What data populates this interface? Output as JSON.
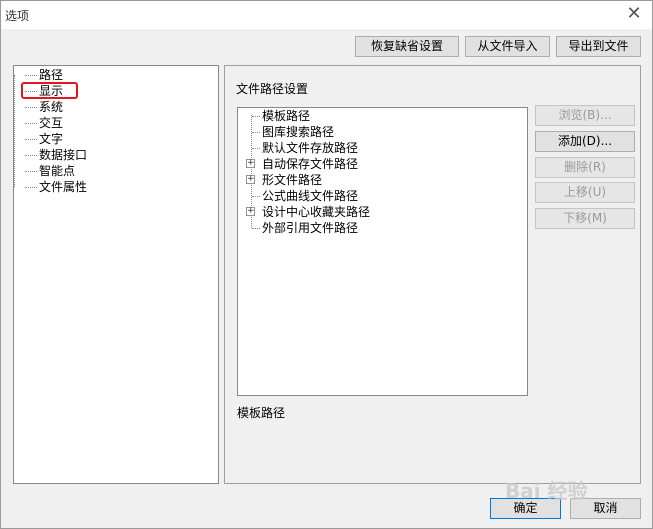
{
  "window": {
    "title": "选项",
    "close_glyph": "✕"
  },
  "top_buttons": {
    "restore_defaults": "恢复缺省设置",
    "import_from_file": "从文件导入",
    "export_to_file": "导出到文件"
  },
  "left_tree": {
    "items": [
      "路径",
      "显示",
      "系统",
      "交互",
      "文字",
      "数据接口",
      "智能点",
      "文件属性"
    ],
    "highlighted": "显示"
  },
  "panel": {
    "title": "文件路径设置",
    "paths": [
      {
        "label": "模板路径",
        "expandable": false
      },
      {
        "label": "图库搜索路径",
        "expandable": false
      },
      {
        "label": "默认文件存放路径",
        "expandable": false
      },
      {
        "label": "自动保存文件路径",
        "expandable": true
      },
      {
        "label": "形文件路径",
        "expandable": true
      },
      {
        "label": "公式曲线文件路径",
        "expandable": false
      },
      {
        "label": "设计中心收藏夹路径",
        "expandable": true
      },
      {
        "label": "外部引用文件路径",
        "expandable": false
      }
    ],
    "expander_glyph": "+",
    "selected_path_label": "模板路径"
  },
  "side_buttons": {
    "browse": "浏览(B)...",
    "add": "添加(D)...",
    "delete": "删除(R)",
    "move_up": "上移(U)",
    "move_down": "下移(M)"
  },
  "bottom_buttons": {
    "ok": "确定",
    "cancel": "取消"
  },
  "watermark": {
    "text": "Bai 经验"
  },
  "colors": {
    "highlight_box": "#e0181b",
    "dialog_bg": "#f0f0f0",
    "default_button_border": "#0078d7"
  }
}
